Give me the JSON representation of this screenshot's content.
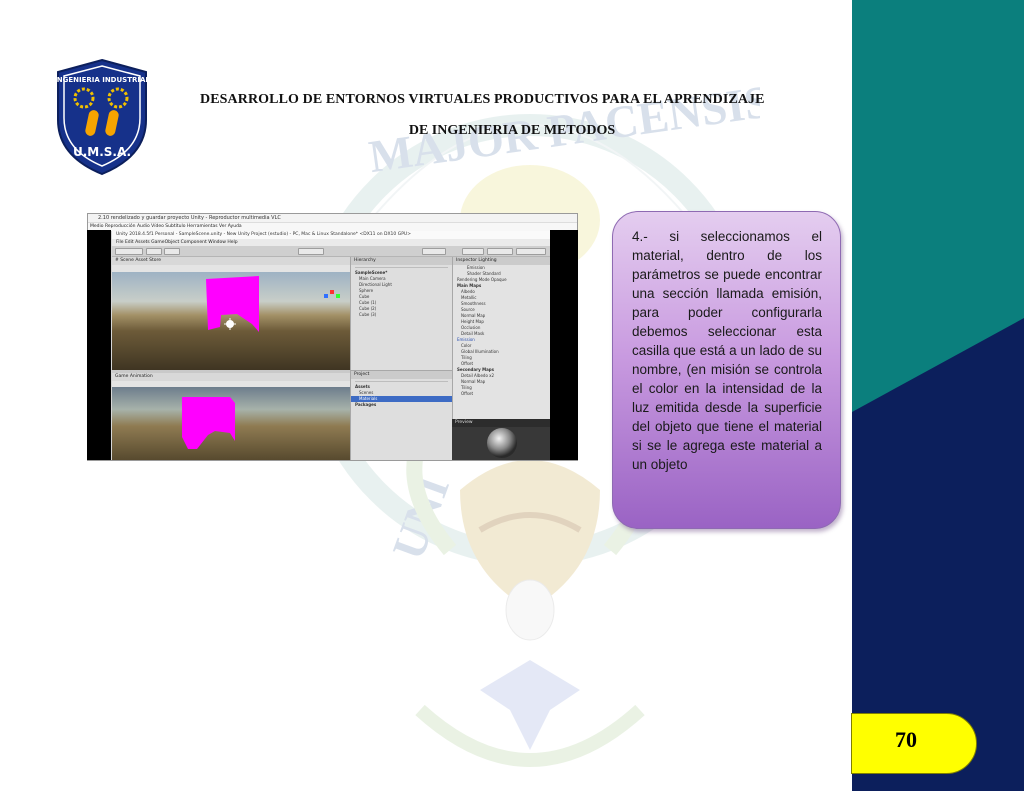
{
  "header": {
    "title_line1": "DESARROLLO DE ENTORNOS VIRTUALES PRODUCTIVOS PARA EL APRENDIZAJE",
    "title_line2": "DE INGENIERIA DE METODOS"
  },
  "logo": {
    "arc_text": "INGENIERIA INDUSTRIAL",
    "institution": "U.M.S.A."
  },
  "watermark": {
    "text_top": "MAJOR PACENSIS",
    "text_side": "UNI"
  },
  "screenshot": {
    "outer_title": "2.10 rendelizado y guardar proyecto Unity - Reproductor multimedia VLC",
    "outer_menu": "Medio   Reproducción   Audio   Vídeo   Subtítulo   Herramientas   Ver   Ayuda",
    "unity_title": "Unity 2018.4.5f1 Personal - SampleScene.unity - New Unity Project (estudio) - PC, Mac & Linux Standalone* <DX11 on DX10 GPU>",
    "unity_menu": "File   Edit   Assets   GameObject   Component   Window   Help",
    "scene_tab": "# Scene    Asset Store",
    "game_tab": "Game    Animation",
    "hierarchy_tab": "Hierarchy",
    "hierarchy_items": [
      "SampleScene*",
      "Main Camera",
      "Directional Light",
      "Sphere",
      "Cube",
      "Cube (1)",
      "Cube (2)",
      "Cube (3)"
    ],
    "project_tab": "Project",
    "project_items": [
      "Assets",
      "Scenes",
      "Materials",
      "Packages"
    ],
    "inspector_tab": "Inspector    Lighting",
    "inspector_items": [
      "Emission",
      "Shader   Standard",
      "Rendering Mode   Opaque",
      "Main Maps",
      "Albedo",
      "Metallic",
      "Smoothness",
      "Source",
      "Normal Map",
      "Height Map",
      "Occlusion",
      "Detail Mask",
      "Emission",
      "Color",
      "Global Illumination",
      "Tiling",
      "Offset",
      "Secondary Maps",
      "Detail Albedo x2",
      "Normal Map",
      "Tiling",
      "Offset"
    ],
    "preview_tab": "Preview"
  },
  "callout": {
    "text": "4.- si seleccionamos el material, dentro de los parámetros se puede encontrar una sección llamada emisión, para poder configurarla debemos seleccionar esta casilla que está a un lado de su nombre, (en misión se controla el color en la intensidad de la luz emitida desde la superficie del objeto que tiene el material si se le agrega este material a un objeto"
  },
  "page": {
    "number": "70"
  },
  "colors": {
    "teal": "#0b7f7d",
    "navy": "#0c1f5c",
    "yellow": "#ffff00",
    "magenta": "#ff00ff",
    "callout_top": "#e4cdef",
    "callout_bottom": "#9a63c4"
  }
}
